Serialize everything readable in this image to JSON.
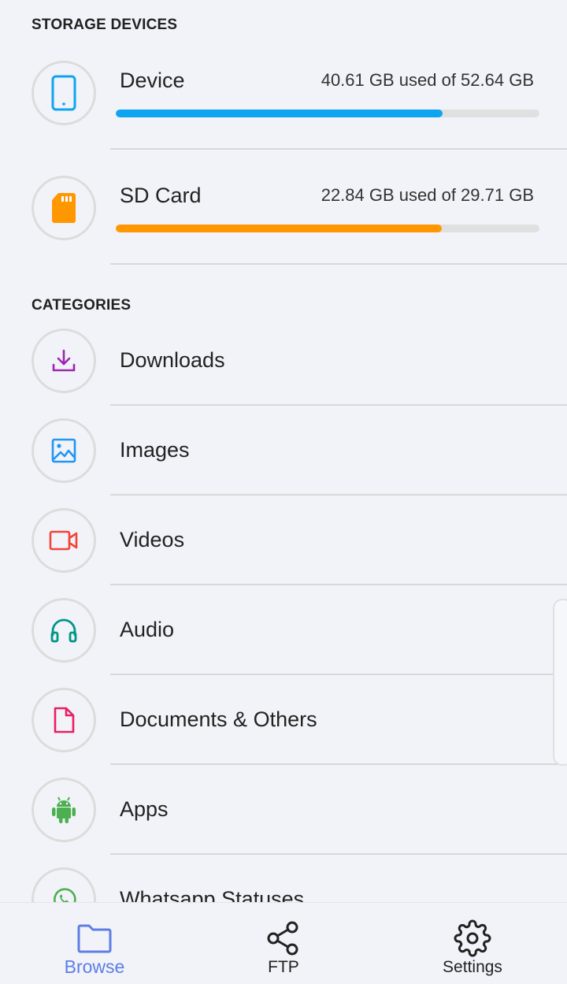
{
  "storage": {
    "section_title": "STORAGE DEVICES",
    "devices": [
      {
        "label": "Device",
        "usage": "40.61 GB used of 52.64 GB",
        "fill_fraction": 0.7715,
        "color": "#0ea5f0",
        "icon": "phone-icon"
      },
      {
        "label": "SD Card",
        "usage": "22.84 GB used of 29.71 GB",
        "fill_fraction": 0.7688,
        "color": "#ff9800",
        "icon": "sd-card-icon"
      }
    ]
  },
  "categories": {
    "section_title": "CATEGORIES",
    "items": [
      {
        "label": "Downloads",
        "icon": "download-icon",
        "color": "#9c27b0"
      },
      {
        "label": "Images",
        "icon": "image-icon",
        "color": "#2196f3"
      },
      {
        "label": "Videos",
        "icon": "video-camera-icon",
        "color": "#f44336"
      },
      {
        "label": "Audio",
        "icon": "headphones-icon",
        "color": "#009688"
      },
      {
        "label": "Documents & Others",
        "icon": "document-icon",
        "color": "#e91e63"
      },
      {
        "label": "Apps",
        "icon": "android-icon",
        "color": "#4caf50"
      },
      {
        "label": "Whatsapp Statuses",
        "icon": "whatsapp-icon",
        "color": "#4caf50"
      }
    ]
  },
  "bottom_nav": {
    "items": [
      {
        "label": "Browse",
        "icon": "folder-icon",
        "active": true
      },
      {
        "label": "FTP",
        "icon": "share-icon",
        "active": false
      },
      {
        "label": "Settings",
        "icon": "gear-icon",
        "active": false
      }
    ],
    "accent": "#5c7ee4"
  }
}
